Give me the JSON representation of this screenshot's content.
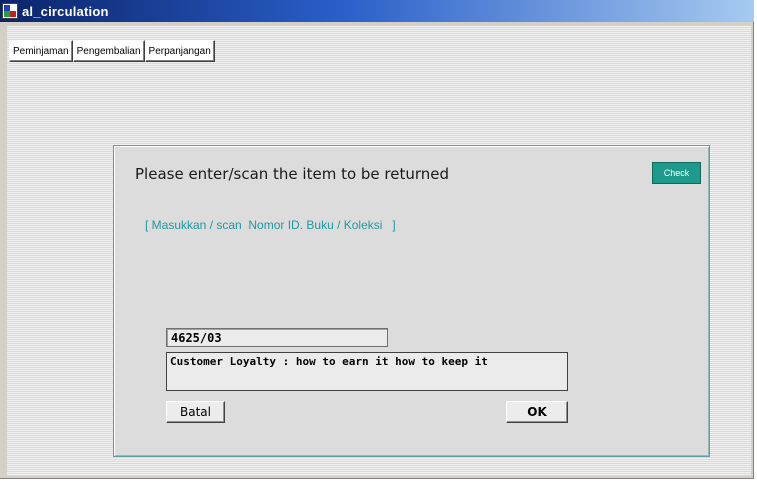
{
  "window": {
    "title": "al_circulation",
    "icon": "app-icon"
  },
  "tabs": [
    {
      "label": "Peminjaman"
    },
    {
      "label": "Pengembalian"
    },
    {
      "label": "Perpanjangan"
    }
  ],
  "dialog": {
    "heading": "Please enter/scan the item to be returned",
    "check_label": "Check",
    "hint": "[ Masukkan / scan  Nomor ID. Buku / Koleksi   ]",
    "item_id_value": "4625/03",
    "item_title_value": "Customer Loyalty : how to earn it how to keep it",
    "cancel_label": "Batal",
    "ok_label": "OK"
  },
  "colors": {
    "title_bar": "#0a246a",
    "accent_teal": "#1e9a8a",
    "hint_text": "#1e9aa0"
  }
}
